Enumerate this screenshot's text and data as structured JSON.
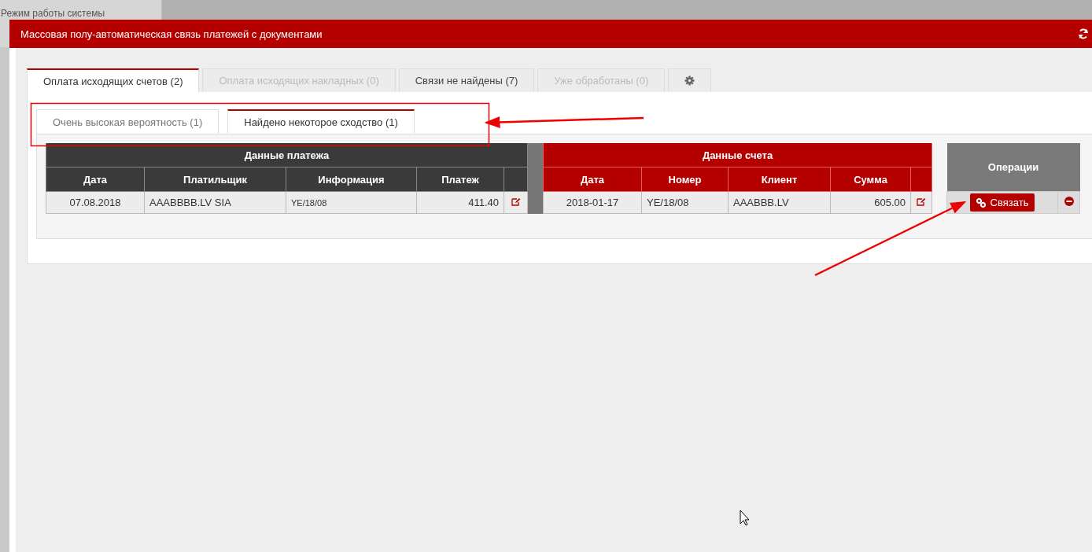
{
  "background_app": {
    "mode_label": "Режим работы системы"
  },
  "dialog": {
    "title": "Массовая полу-автоматическая связь платежей с документами"
  },
  "tabs": [
    {
      "kind": "text",
      "label": "Оплата исходящих счетов (2)",
      "selected": true,
      "disabled": false
    },
    {
      "kind": "text",
      "label": "Оплата исходящих накладных (0)",
      "selected": false,
      "disabled": true
    },
    {
      "kind": "text",
      "label": "Связи не найдены (7)",
      "selected": false,
      "disabled": false
    },
    {
      "kind": "text",
      "label": "Уже обработаны (0)",
      "selected": false,
      "disabled": true
    },
    {
      "kind": "settings",
      "selected": false
    }
  ],
  "subtabs": [
    {
      "label": "Очень высокая вероятность (1)",
      "selected": false
    },
    {
      "label": "Найдено некоторое сходство (1)",
      "selected": true
    }
  ],
  "payment": {
    "title": "Данные платежа",
    "columns": [
      "Дата",
      "Платильщик",
      "Информация",
      "Платеж"
    ],
    "rows": [
      [
        "07.08.2018",
        "AAABBBB.LV SIA",
        "YE/18/08",
        "411.40"
      ]
    ]
  },
  "invoice": {
    "title": "Данные счета",
    "columns": [
      "Дата",
      "Номер",
      "Клиент",
      "Сумма"
    ],
    "rows": [
      [
        "2018-01-17",
        "YE/18/08",
        "AAABBB.LV",
        "605.00"
      ]
    ]
  },
  "operations": {
    "title": "Операции",
    "rows": [
      {
        "action": "Связать"
      }
    ]
  }
}
